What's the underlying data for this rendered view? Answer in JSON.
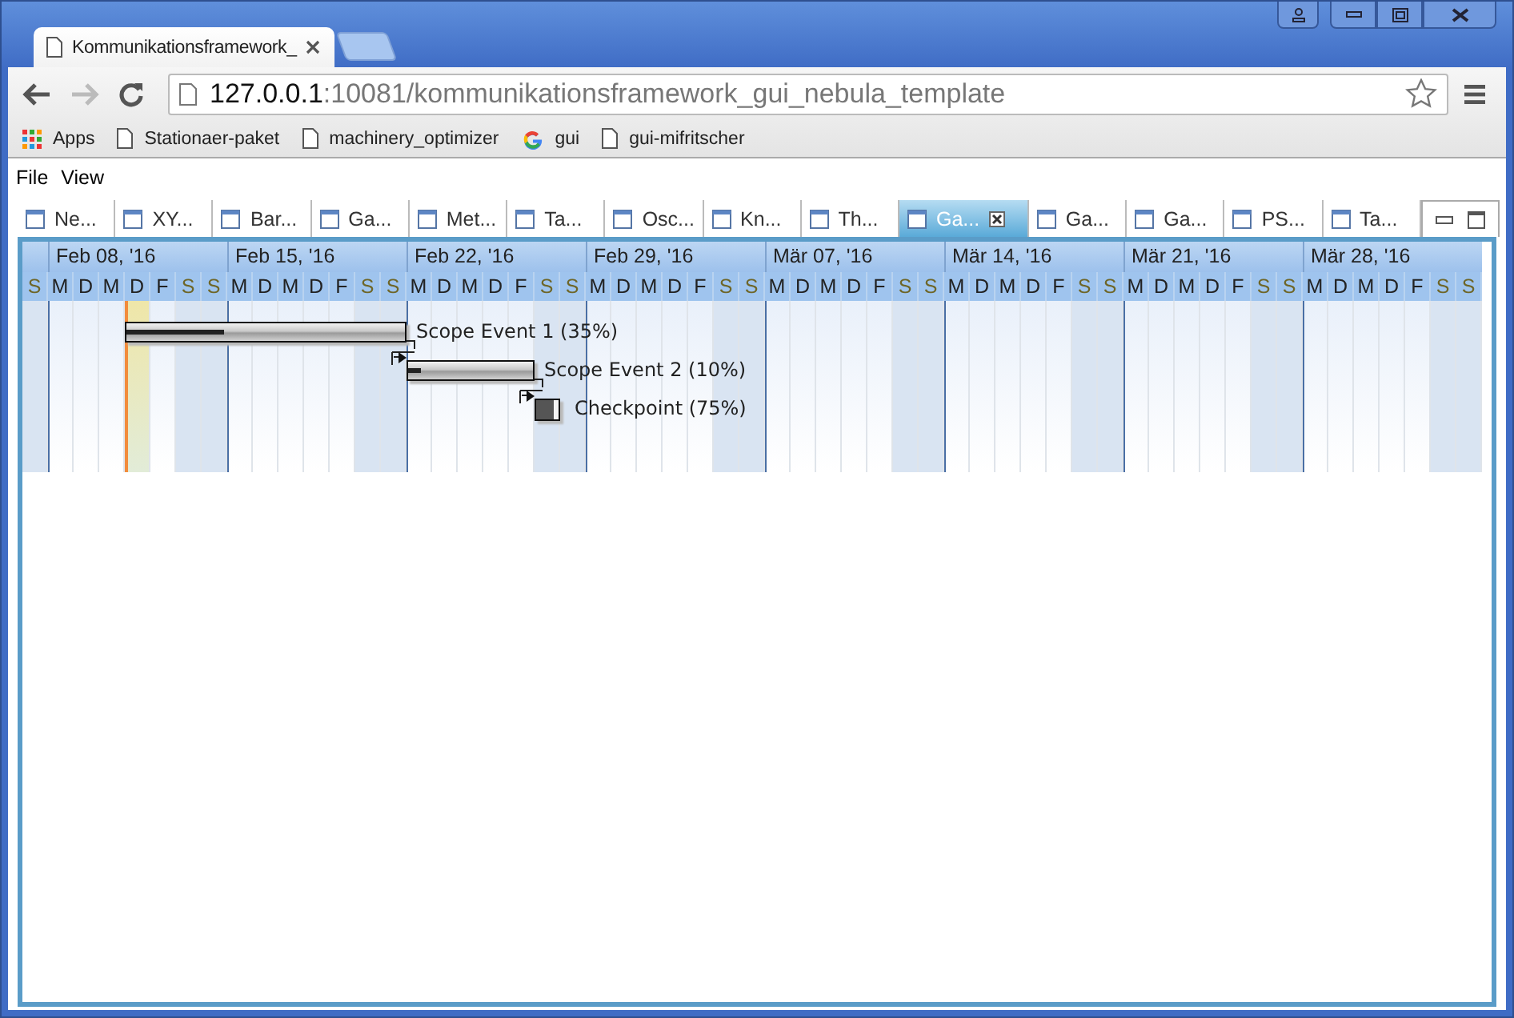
{
  "browser": {
    "tab_title": "Kommunikationsframework_",
    "url": {
      "host": "127.0.0.1",
      "path": ":10081/kommunikationsframework_gui_nebula_template"
    },
    "bookmarks": [
      {
        "kind": "apps",
        "label": "Apps"
      },
      {
        "kind": "page",
        "label": "Stationaer-paket"
      },
      {
        "kind": "page",
        "label": "machinery_optimizer"
      },
      {
        "kind": "google",
        "label": "gui"
      },
      {
        "kind": "page",
        "label": "gui-mifritscher"
      }
    ]
  },
  "menu": [
    "File",
    "View"
  ],
  "tabs": [
    {
      "label": "Ne...",
      "selected": false
    },
    {
      "label": "XY...",
      "selected": false
    },
    {
      "label": "Bar...",
      "selected": false
    },
    {
      "label": "Ga...",
      "selected": false
    },
    {
      "label": "Met...",
      "selected": false
    },
    {
      "label": "Ta...",
      "selected": false
    },
    {
      "label": "Osc...",
      "selected": false
    },
    {
      "label": "Kn...",
      "selected": false
    },
    {
      "label": "Th...",
      "selected": false
    },
    {
      "label": "Ga...",
      "selected": true
    },
    {
      "label": "Ga...",
      "selected": false
    },
    {
      "label": "Ga...",
      "selected": false
    },
    {
      "label": "PS...",
      "selected": false
    },
    {
      "label": "Ta...",
      "selected": false
    }
  ],
  "gantt": {
    "weeks": [
      "Feb 08, '16",
      "Feb 15, '16",
      "Feb 22, '16",
      "Feb 29, '16",
      "Mär 07, '16",
      "Mär 14, '16",
      "Mär 21, '16",
      "Mär 28, '16"
    ],
    "days": [
      {
        "label": "S",
        "weekend": true,
        "today": false
      },
      {
        "label": "M",
        "weekend": false,
        "today": false
      },
      {
        "label": "D",
        "weekend": false,
        "today": false
      },
      {
        "label": "M",
        "weekend": false,
        "today": false
      },
      {
        "label": "D",
        "weekend": false,
        "today": true
      },
      {
        "label": "F",
        "weekend": false,
        "today": false
      },
      {
        "label": "S",
        "weekend": true,
        "today": false
      },
      {
        "label": "S",
        "weekend": true,
        "today": false
      },
      {
        "label": "M",
        "weekend": false,
        "today": false
      },
      {
        "label": "D",
        "weekend": false,
        "today": false
      },
      {
        "label": "M",
        "weekend": false,
        "today": false
      },
      {
        "label": "D",
        "weekend": false,
        "today": false
      },
      {
        "label": "F",
        "weekend": false,
        "today": false
      },
      {
        "label": "S",
        "weekend": true,
        "today": false
      },
      {
        "label": "S",
        "weekend": true,
        "today": false
      },
      {
        "label": "M",
        "weekend": false,
        "today": false
      },
      {
        "label": "D",
        "weekend": false,
        "today": false
      },
      {
        "label": "M",
        "weekend": false,
        "today": false
      },
      {
        "label": "D",
        "weekend": false,
        "today": false
      },
      {
        "label": "F",
        "weekend": false,
        "today": false
      },
      {
        "label": "S",
        "weekend": true,
        "today": false
      },
      {
        "label": "S",
        "weekend": true,
        "today": false
      },
      {
        "label": "M",
        "weekend": false,
        "today": false
      },
      {
        "label": "D",
        "weekend": false,
        "today": false
      },
      {
        "label": "M",
        "weekend": false,
        "today": false
      },
      {
        "label": "D",
        "weekend": false,
        "today": false
      },
      {
        "label": "F",
        "weekend": false,
        "today": false
      },
      {
        "label": "S",
        "weekend": true,
        "today": false
      },
      {
        "label": "S",
        "weekend": true,
        "today": false
      },
      {
        "label": "M",
        "weekend": false,
        "today": false
      },
      {
        "label": "D",
        "weekend": false,
        "today": false
      },
      {
        "label": "M",
        "weekend": false,
        "today": false
      },
      {
        "label": "D",
        "weekend": false,
        "today": false
      },
      {
        "label": "F",
        "weekend": false,
        "today": false
      },
      {
        "label": "S",
        "weekend": true,
        "today": false
      },
      {
        "label": "S",
        "weekend": true,
        "today": false
      },
      {
        "label": "M",
        "weekend": false,
        "today": false
      },
      {
        "label": "D",
        "weekend": false,
        "today": false
      },
      {
        "label": "M",
        "weekend": false,
        "today": false
      },
      {
        "label": "D",
        "weekend": false,
        "today": false
      },
      {
        "label": "F",
        "weekend": false,
        "today": false
      },
      {
        "label": "S",
        "weekend": true,
        "today": false
      },
      {
        "label": "S",
        "weekend": true,
        "today": false
      },
      {
        "label": "M",
        "weekend": false,
        "today": false
      },
      {
        "label": "D",
        "weekend": false,
        "today": false
      },
      {
        "label": "M",
        "weekend": false,
        "today": false
      },
      {
        "label": "D",
        "weekend": false,
        "today": false
      },
      {
        "label": "F",
        "weekend": false,
        "today": false
      },
      {
        "label": "S",
        "weekend": true,
        "today": false
      },
      {
        "label": "S",
        "weekend": true,
        "today": false
      },
      {
        "label": "M",
        "weekend": false,
        "today": false
      },
      {
        "label": "D",
        "weekend": false,
        "today": false
      },
      {
        "label": "M",
        "weekend": false,
        "today": false
      },
      {
        "label": "D",
        "weekend": false,
        "today": false
      },
      {
        "label": "F",
        "weekend": false,
        "today": false
      },
      {
        "label": "S",
        "weekend": true,
        "today": false
      },
      {
        "label": "S",
        "weekend": true,
        "today": false
      }
    ],
    "events": [
      {
        "kind": "task",
        "label": "Scope Event 1 (35%)",
        "level": 0.35
      },
      {
        "kind": "task",
        "label": "Scope Event 2 (10%)",
        "level": 0.1
      },
      {
        "kind": "checkpoint",
        "label": "Checkpoint (75%)",
        "level": 0.75
      }
    ]
  }
}
